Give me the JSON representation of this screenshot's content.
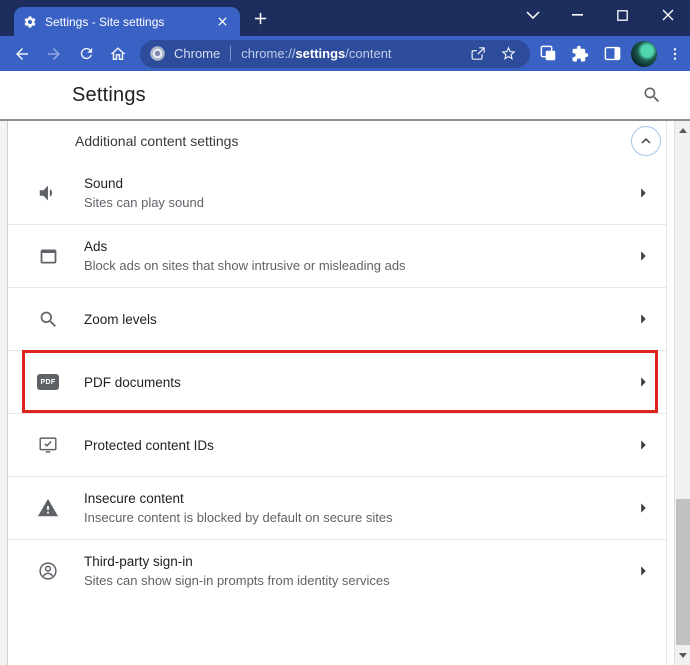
{
  "colors": {
    "titlebar": "#1d2d5d",
    "toolbar": "#3a62c4",
    "omnibox": "#2d4c9b",
    "highlight": "#df231e"
  },
  "browser": {
    "tab": {
      "title": "Settings - Site settings"
    },
    "omnibox": {
      "site_label": "Chrome",
      "url_prefix": "chrome://",
      "url_bold": "settings",
      "url_suffix": "/content"
    }
  },
  "header": {
    "title": "Settings"
  },
  "content": {
    "section_label": "Additional content settings",
    "pdf_badge_label": "PDF",
    "rows": [
      {
        "icon": "volume-icon",
        "title": "Sound",
        "subtitle": "Sites can play sound"
      },
      {
        "icon": "ads-icon",
        "title": "Ads",
        "subtitle": "Block ads on sites that show intrusive or misleading ads"
      },
      {
        "icon": "zoom-levels-icon",
        "title": "Zoom levels",
        "subtitle": ""
      },
      {
        "icon": "pdf-icon",
        "title": "PDF documents",
        "subtitle": "",
        "highlighted": true
      },
      {
        "icon": "protected-content-icon",
        "title": "Protected content IDs",
        "subtitle": ""
      },
      {
        "icon": "warning-icon",
        "title": "Insecure content",
        "subtitle": "Insecure content is blocked by default on secure sites"
      },
      {
        "icon": "person-icon",
        "title": "Third-party sign-in",
        "subtitle": "Sites can show sign-in prompts from identity services"
      }
    ]
  }
}
